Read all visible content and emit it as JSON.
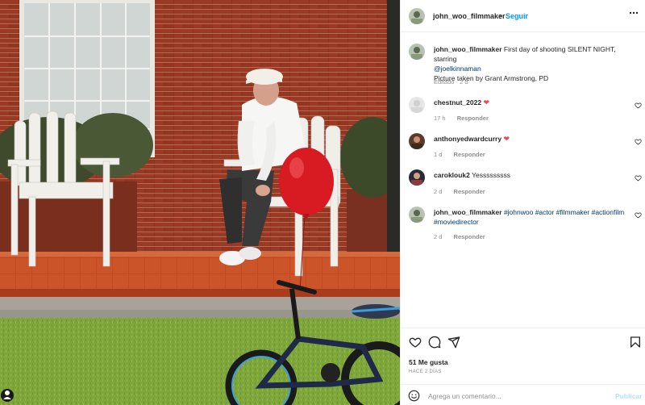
{
  "post": {
    "username": "john_woo_filmmaker",
    "separator": "•",
    "follow_label": "Seguir",
    "more_icon": "more-horizontal-icon",
    "photo_alt": "Man in white cap and shirt sitting on a white wooden chair in front of a brick wall, red balloon and child's bicycle in the foreground"
  },
  "caption": {
    "username": "john_woo_filmmaker",
    "text_1": " First day of shooting SILENT NIGHT, starring ",
    "mention": "@joelkinnaman",
    "line_2": "Picture taken by Grant Armstrong, PD",
    "edited_label": "Editado · 2 d"
  },
  "comments": [
    {
      "username": "chestnut_2022",
      "text": "",
      "emoji": "❤",
      "time": "17 h",
      "reply_label": "Responder"
    },
    {
      "username": "anthonyedwardcurry",
      "text": "",
      "emoji": "❤",
      "time": "1 d",
      "reply_label": "Responder"
    },
    {
      "username": "caroklouk2",
      "text": " Yesssssssss",
      "emoji": "",
      "time": "2 d",
      "reply_label": "Responder"
    },
    {
      "username": "john_woo_filmmaker",
      "text": "",
      "hashtags": "#johnwoo #actor #filmmaker #actionfilm #moviedirector",
      "emoji": "",
      "time": "2 d",
      "reply_label": "Responder"
    }
  ],
  "actions": {
    "icons": [
      "heart-outline-icon",
      "comment-icon",
      "share-icon",
      "bookmark-icon"
    ],
    "likes": "51 Me gusta",
    "ago": "HACE 2 DÍAS"
  },
  "composer": {
    "placeholder": "Agrega un comentario...",
    "publish_label": "Publicar"
  },
  "colors": {
    "accent": "#0095f6",
    "link": "#00376b",
    "heart": "#ed4956",
    "muted": "#8e8e8e"
  }
}
